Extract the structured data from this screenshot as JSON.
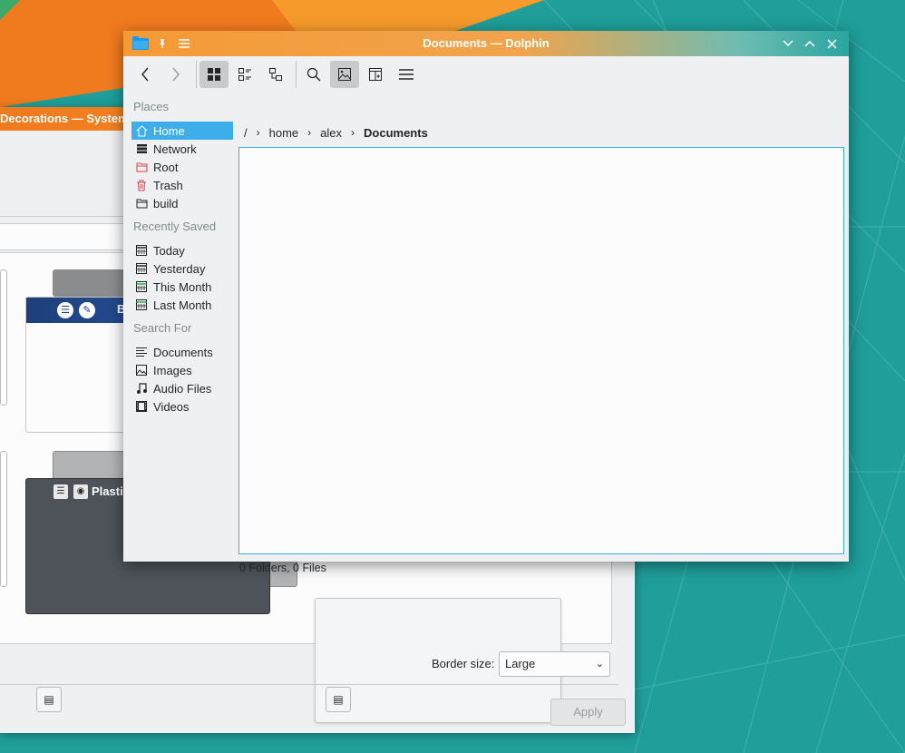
{
  "desktop": {
    "accent_colors": [
      "#f07a1e",
      "#1d9a97",
      "#3daee9"
    ]
  },
  "settings_window": {
    "title": "Decorations — System S",
    "preview_labels": [
      "B",
      "Plastik"
    ],
    "border_size_label": "Border size:",
    "border_size_value": "Large",
    "apply_label": "Apply"
  },
  "dolphin": {
    "title": "Documents — Dolphin",
    "window_buttons": [
      "minimize-icon",
      "maximize-icon",
      "close-icon"
    ],
    "toolbar": [
      "back",
      "forward",
      "icons-view",
      "compact-view",
      "details-view",
      "search",
      "preview",
      "split",
      "menu"
    ],
    "places": {
      "heading": "Places",
      "items": [
        {
          "label": "Home",
          "icon": "home-icon",
          "selected": true
        },
        {
          "label": "Network",
          "icon": "network-icon"
        },
        {
          "label": "Root",
          "icon": "root-folder-icon"
        },
        {
          "label": "Trash",
          "icon": "trash-icon"
        },
        {
          "label": "build",
          "icon": "folder-icon"
        }
      ]
    },
    "recent": {
      "heading": "Recently Saved",
      "items": [
        {
          "label": "Today",
          "icon": "calendar-icon"
        },
        {
          "label": "Yesterday",
          "icon": "calendar-icon"
        },
        {
          "label": "This Month",
          "icon": "calendar-icon"
        },
        {
          "label": "Last Month",
          "icon": "calendar-icon"
        }
      ]
    },
    "search": {
      "heading": "Search For",
      "items": [
        {
          "label": "Documents",
          "icon": "document-icon"
        },
        {
          "label": "Images",
          "icon": "image-icon"
        },
        {
          "label": "Audio Files",
          "icon": "audio-icon"
        },
        {
          "label": "Videos",
          "icon": "video-icon"
        }
      ]
    },
    "breadcrumb": {
      "root": "/",
      "parts": [
        "home",
        "alex"
      ],
      "current": "Documents"
    },
    "status": "0 Folders, 0 Files"
  }
}
